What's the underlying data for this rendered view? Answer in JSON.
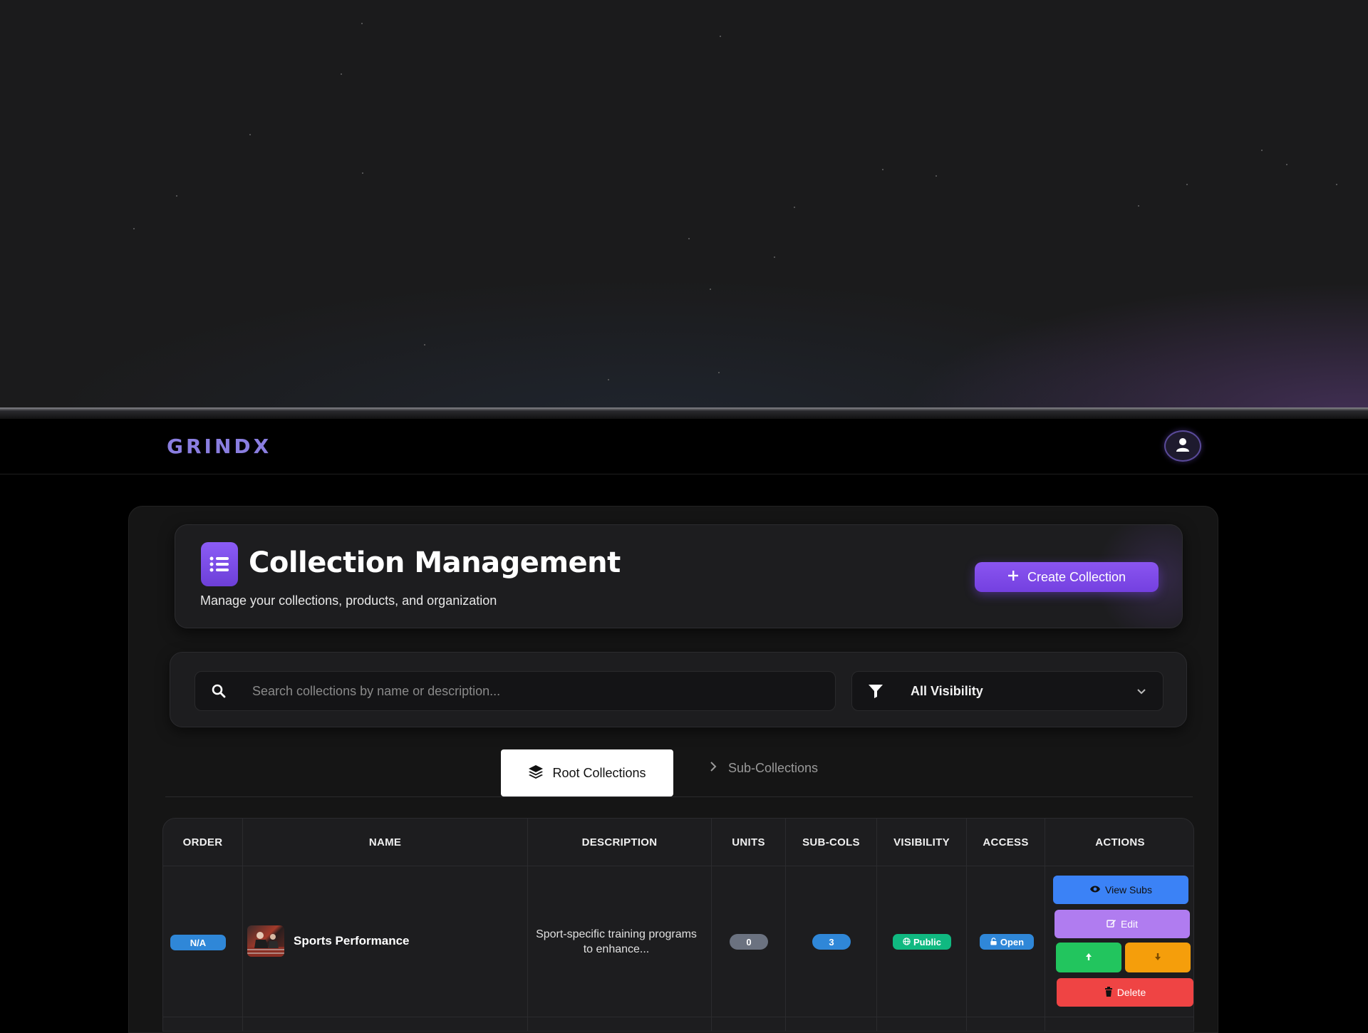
{
  "brand": {
    "logo_text": "GRINDX"
  },
  "header": {
    "title": "Collection Management",
    "subtitle": "Manage your collections, products, and organization",
    "create_button": "Create Collection"
  },
  "filters": {
    "search_placeholder": "Search collections by name or description...",
    "visibility_selected": "All Visibility"
  },
  "tabs": [
    {
      "label": "Root Collections",
      "active": true
    },
    {
      "label": "Sub-Collections",
      "active": false
    }
  ],
  "table": {
    "columns": [
      "ORDER",
      "NAME",
      "DESCRIPTION",
      "UNITS",
      "SUB-COLS",
      "VISIBILITY",
      "ACCESS",
      "ACTIONS"
    ],
    "rows": [
      {
        "order": "N/A",
        "name": "Sports Performance",
        "description": "Sport-specific training programs to enhance...",
        "units": "0",
        "sub_cols": "3",
        "visibility": "Public",
        "access": "Open",
        "actions": {
          "view": "View Subs",
          "edit": "Edit",
          "delete": "Delete"
        }
      }
    ]
  },
  "icons": {
    "header": "list-icon",
    "create": "plus-icon",
    "search": "search-icon",
    "filter": "filter-icon",
    "dropdown": "chevron-down-icon",
    "root_tab": "layers-icon",
    "sub_tab": "chevron-right-icon",
    "avatar": "user-icon",
    "view": "eye-icon",
    "edit": "edit-icon",
    "up": "arrow-up-icon",
    "down": "arrow-down-icon",
    "delete": "trash-icon",
    "visibility": "globe-icon",
    "access": "unlock-icon"
  },
  "colors": {
    "accent": "#7c4dea",
    "order_badge": "#2f87d8",
    "units_badge": "#6b7280",
    "subcols_badge": "#2f87d8",
    "public_badge": "#10b981",
    "open_badge": "#2f87d8",
    "view_button": "#3b82f6",
    "edit_button": "#b07cf0",
    "up_button": "#22c55e",
    "down_button": "#f59e0b",
    "delete_button": "#ef4444"
  }
}
